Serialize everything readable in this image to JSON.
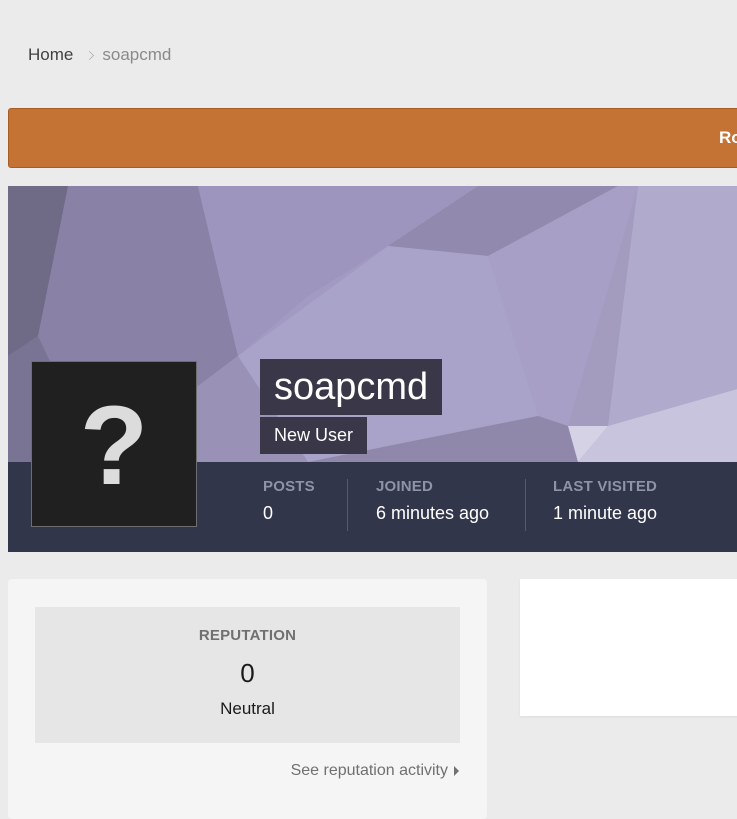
{
  "breadcrumb": {
    "home": "Home",
    "current": "soapcmd"
  },
  "banner": {
    "text": "Ro",
    "color": "#c47334"
  },
  "profile": {
    "username": "soapcmd",
    "usergroup": "New User",
    "avatar_glyph": "?",
    "stats": [
      {
        "label": "POSTS",
        "value": "0"
      },
      {
        "label": "JOINED",
        "value": "6 minutes ago"
      },
      {
        "label": "LAST VISITED",
        "value": "1 minute ago"
      }
    ]
  },
  "reputation": {
    "label": "REPUTATION",
    "value": "0",
    "status": "Neutral",
    "link": "See reputation activity"
  },
  "colors": {
    "background": "#ebebeb",
    "stats_bar": "#32364a",
    "cover": "#a39cbf"
  }
}
